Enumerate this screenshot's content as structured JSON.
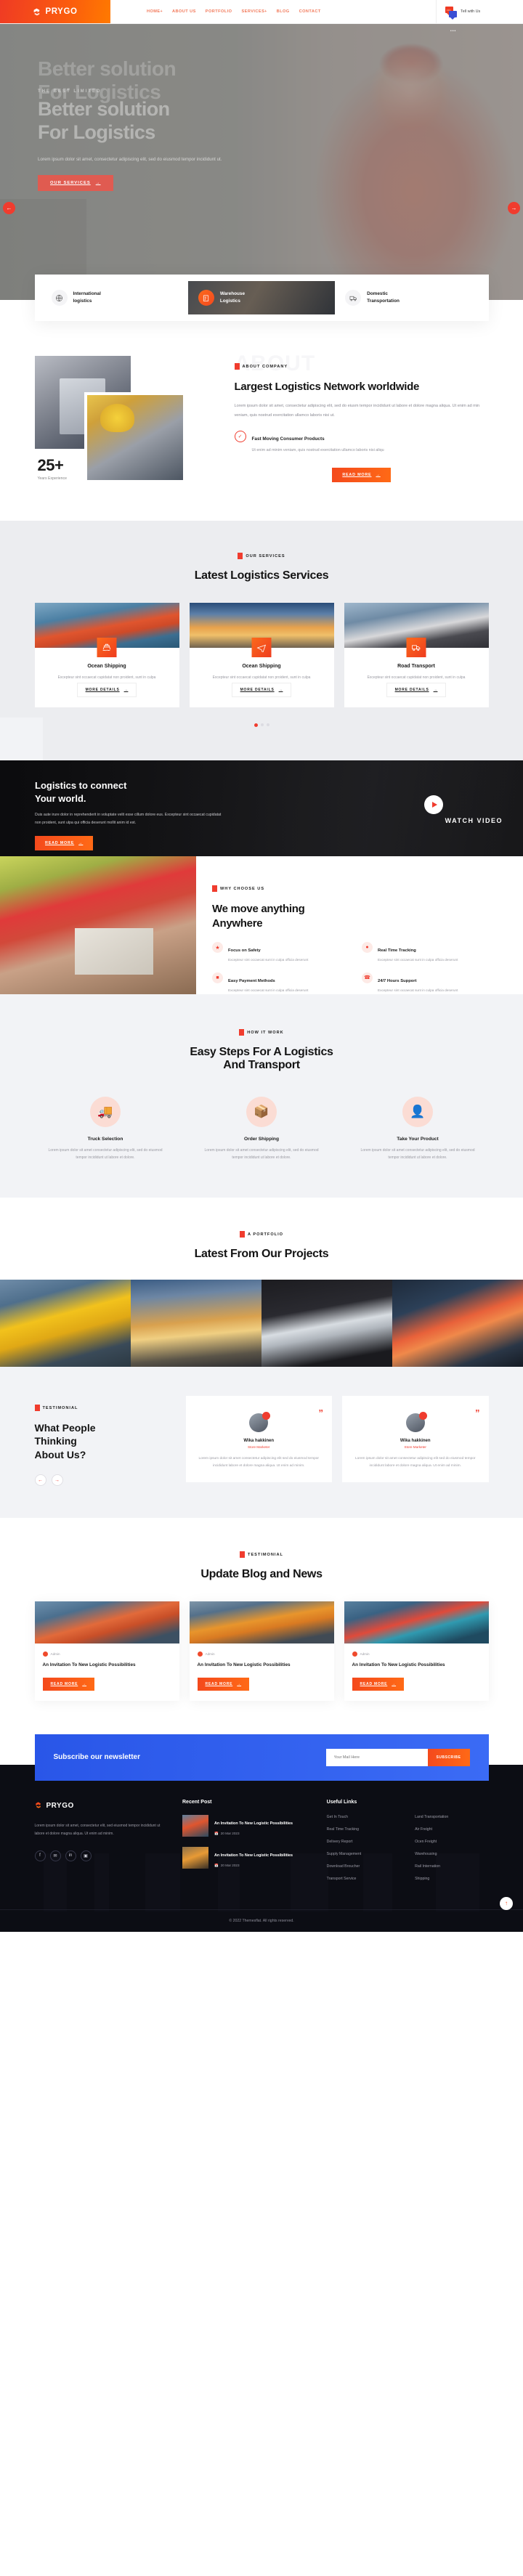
{
  "header": {
    "brand": "PRYGO",
    "nav": [
      {
        "label": "HOME",
        "caret": "+"
      },
      {
        "label": "ABOUT US",
        "caret": ""
      },
      {
        "label": "PORTFOLIO",
        "caret": ""
      },
      {
        "label": "SERVICES",
        "caret": "+"
      },
      {
        "label": "BLOG",
        "caret": ""
      },
      {
        "label": "CONTACT",
        "caret": ""
      }
    ],
    "chat_label": "Tell with Us"
  },
  "hero": {
    "ghost_line1": "Better solution",
    "ghost_line2": "For Logistics",
    "kicker": "THE BEST LIMITED",
    "title_line1": "Better solution",
    "title_line2": "For Logistics",
    "desc": "Lorem ipsum dolor sit amet, consectetur adipiscing elit, sed do eiusmod tempor incididunt ut.",
    "cta": "OUR SERVICES",
    "arrow_prev": "←",
    "arrow_next": "→"
  },
  "tabs": [
    {
      "label_line1": "International",
      "label_line2": "logistics",
      "icon": "globe-icon",
      "active": false
    },
    {
      "label_line1": "Warehouse",
      "label_line2": "Logistics",
      "icon": "warehouse-icon",
      "active": true
    },
    {
      "label_line1": "Domestic",
      "label_line2": "Transportation",
      "icon": "truck-icon",
      "active": false
    }
  ],
  "about": {
    "watermark": "ABOUT",
    "kicker": "ABOUT COMPANY",
    "title": "Largest Logistics Network worldwide",
    "paragraph": "Lorem ipsum dolor sit amet, consectetur adipiscing elit, sed do eiusm tempor incididunt ut labore et dolore magna aliqua. Ut enim ad min veniam, quis nostrud exercitation ullamco laboris nisi ut.",
    "feature_title": "Fast Moving Consumer Products",
    "feature_text": "Ut enim ad minim veniam, quis nostrud exercitation ullamco laboris nisi aliqu",
    "cta": "READ MORE",
    "exp_number": "25+",
    "exp_label": "Years Experience"
  },
  "services": {
    "kicker": "OUR SERVICES",
    "title": "Latest Logistics Services",
    "cards": [
      {
        "title": "Ocean Shipping",
        "text": "Excepteur sint occaecat cupidatat non proident, sunt in culpa",
        "cta": "MORE DETAILS",
        "icon": "ship-icon"
      },
      {
        "title": "Ocean Shipping",
        "text": "Excepteur sint occaecat cupidatat non proident, sunt in culpa",
        "cta": "MORE DETAILS",
        "icon": "plane-icon"
      },
      {
        "title": "Road Transport",
        "text": "Excepteur sint occaecat cupidatat non proident, sunt in culpa",
        "cta": "MORE DETAILS",
        "icon": "truck-icon"
      }
    ]
  },
  "video": {
    "title_line1": "Logistics to connect",
    "title_line2": "Your world.",
    "desc": "Duis aute irure dolor in reprehenderit in voluptate velit esse cillum dolore eus. Excepteur sint occaecat cupidatat non proident, sunt ulpa qui officia deserunt mollit anim id est.",
    "cta": "READ MORE",
    "watch_label": "WATCH VIDEO"
  },
  "choose": {
    "kicker": "WHY CHOOSE US",
    "title_line1": "We move anything",
    "title_line2": "Anywhere",
    "items": [
      {
        "title": "Focus on Safety",
        "text": "Excepteur sint occaecat sunt in culpa officia deserunt",
        "icon": "shield-icon"
      },
      {
        "title": "Real Time Tracking",
        "text": "Excepteur sint occaecat sunt in culpa officia deserunt",
        "icon": "location-icon"
      },
      {
        "title": "Easy Payment Methods",
        "text": "Excepteur sint occaecat sunt in culpa officia deserunt",
        "icon": "card-icon"
      },
      {
        "title": "24/7 Hours Support",
        "text": "Excepteur sint occaecat sunt in culpa officia deserunt",
        "icon": "headset-icon"
      }
    ]
  },
  "steps": {
    "kicker": "HOW IT WORK",
    "title_line1": "Easy Steps For A Logistics",
    "title_line2": "And Transport",
    "items": [
      {
        "title": "Truck Selection",
        "text": "Lorem ipsum dolor sit amet consectetur adipiscing elit, sed do eiusmod tempor incididunt ut labore et dolore.",
        "icon": "truck-select-icon"
      },
      {
        "title": "Order Shipping",
        "text": "Lorem ipsum dolor sit amet consectetur adipiscing elit, sed do eiusmod tempor incididunt ut labore et dolore.",
        "icon": "order-icon"
      },
      {
        "title": "Take Your Product",
        "text": "Lorem ipsum dolor sit amet consectetur adipiscing elit, sed do eiusmod tempor incididunt ut labore et dolore.",
        "icon": "package-icon"
      }
    ]
  },
  "portfolio": {
    "kicker": "A PORTFOLIO",
    "title": "Latest From Our Projects"
  },
  "testimonial": {
    "kicker": "TESTIMONIAL",
    "title_line1": "What People",
    "title_line2": "Thinking",
    "title_line3": "About Us?",
    "prev": "←",
    "next": "→",
    "cards": [
      {
        "name": "Wika hakkinen",
        "role": "Store Marketer",
        "text": "Lorem ipsum dolor sit amet consectetur adipiscing elit sed do eiusmod tempor incididunt labore et dolore magna aliqua. Ut enim ad minim.",
        "quote": "”"
      },
      {
        "name": "Wika hakkinen",
        "role": "Store Marketer",
        "text": "Lorem ipsum dolor sit amet consectetur adipiscing elit sed do eiusmod tempor incididunt labore et dolore magna aliqua. Ut enim ad minim.",
        "quote": "”"
      }
    ]
  },
  "blog": {
    "kicker": "TESTIMONIAL",
    "title": "Update Blog and News",
    "cards": [
      {
        "author": "Admin",
        "title": "An Invitation To New Logistic Possibilities",
        "cta": "READ MORE"
      },
      {
        "author": "Admin",
        "title": "An Invitation To New Logistic Possibilities",
        "cta": "READ MORE"
      },
      {
        "author": "Admin",
        "title": "An Invitation To New Logistic Possibilities",
        "cta": "READ MORE"
      }
    ]
  },
  "newsletter": {
    "title": "Subscribe our newsletter",
    "placeholder": "Your Mail Here",
    "button": "SUBSCRIBE"
  },
  "footer": {
    "brand": "PRYGO",
    "about": "Lorem ipsum dolor sit amet, consectetur elit, sed eiusmod tempor incididunt ut labore et dolore magna aliqua. Ut enim ad minim.",
    "socials": [
      {
        "icon": "facebook-icon",
        "glyph": "f"
      },
      {
        "icon": "twitter-icon",
        "glyph": "✉"
      },
      {
        "icon": "linkedin-icon",
        "glyph": "in"
      },
      {
        "icon": "instagram-icon",
        "glyph": "▣"
      }
    ],
    "recent_title": "Recent Post",
    "posts": [
      {
        "title": "An Invitation To New Logistic Possibilities",
        "date": "20 Mar 2023"
      },
      {
        "title": "An Invitation To New Logistic Possibilities",
        "date": "20 Mar 2023"
      }
    ],
    "links_title": "Useful Links",
    "links_col1": [
      "Get In Touch",
      "Real Time Tracking",
      "Delivery Report",
      "Supply Management",
      "Download Broucher",
      "Transport Service"
    ],
    "links_col2": [
      "Land Transportation",
      "Air Freight",
      "Ocen Freight",
      "Warehousing",
      "Rail Internation",
      "Shipping"
    ],
    "copyright": "© 2022 Themesflat. All rights reserved.",
    "totop": "↑"
  },
  "colors": {
    "accent": "#f03c2e",
    "accent2": "#ff6a16",
    "blue": "#2956e8",
    "dark": "#0c0d14"
  }
}
